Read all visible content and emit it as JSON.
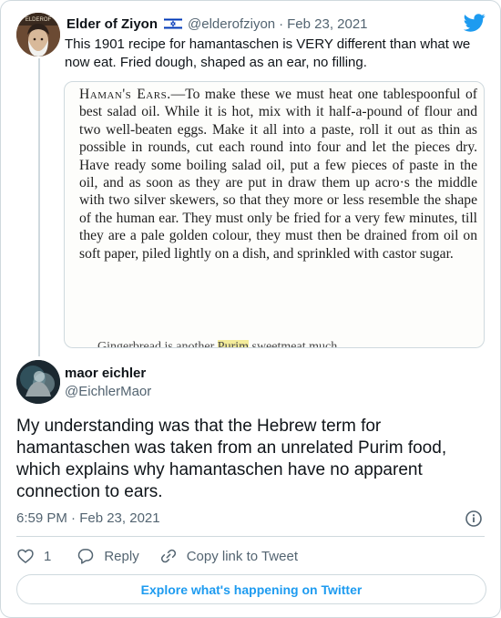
{
  "accent_color": "#1d9bf0",
  "secondary_text_color": "#536471",
  "parent_tweet": {
    "author_name": "Elder of Ziyon",
    "avatar_text": "ELDEROF",
    "flag_icon": "israel-flag-icon",
    "handle": "@elderofziyon",
    "separator": "·",
    "date": "Feb 23, 2021",
    "text": "This 1901 recipe for hamantaschen is VERY different than what we now eat. Fried dough, shaped as an ear, no filling.",
    "media": {
      "title": "Haman's Ears.",
      "body_before_title": "",
      "body": "—To make these we must heat one tablespoonful of best salad oil. While it is hot, mix with it half-a-pound of flour and two well-beaten eggs. Make it all into a paste, roll it out as thin as possible in rounds, cut each round into four and let the pieces dry. Have ready some boiling salad oil, put a few pieces of paste in the oil, and as soon as they are put in draw them up acro·s the middle with two silver skewers, so that they more or less resemble the shape of the human ear. They must only be fried for a very few minutes, till they are a pale golden colour, they must then be drained from oil on soft paper, piled lightly on a dish, and sprinkled with castor sugar.",
      "cutoff_before": "Gingerbread is another ",
      "cutoff_highlight": "Purim",
      "cutoff_after": " sweetmeat much"
    }
  },
  "reply_tweet": {
    "author_name": "maor eichler",
    "handle": "@EichlerMaor",
    "text": "My understanding was that the Hebrew term for hamantaschen was taken from an unrelated Purim food, which explains why hamantaschen have no apparent connection to ears.",
    "timestamp": "6:59 PM · Feb 23, 2021",
    "info_icon": "info-icon"
  },
  "actions": {
    "like_icon": "heart-icon",
    "like_count": "1",
    "reply_icon": "reply-bubble-icon",
    "reply_label": "Reply",
    "copy_icon": "link-icon",
    "copy_label": "Copy link to Tweet"
  },
  "explore_button": {
    "label": "Explore what's happening on Twitter"
  },
  "brand_icon": "twitter-bird-icon"
}
